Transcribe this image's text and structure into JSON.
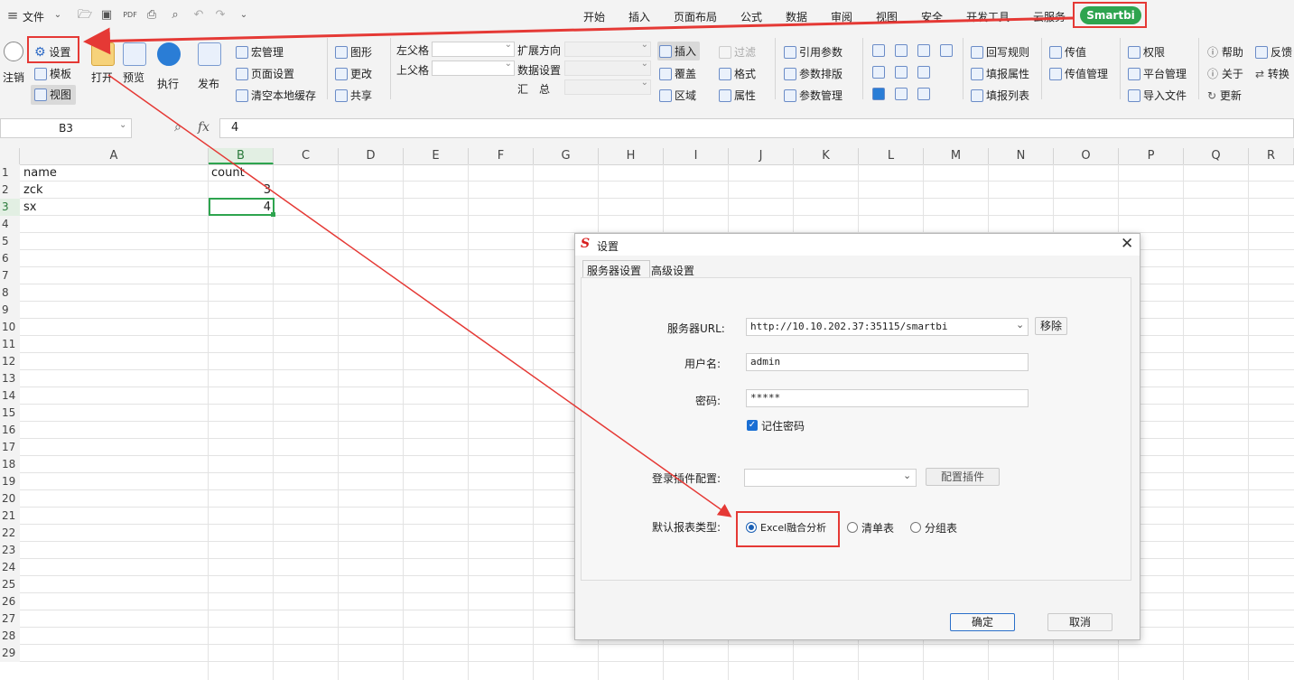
{
  "menubar": {
    "file_label": "文件",
    "tabs": [
      "开始",
      "插入",
      "页面布局",
      "公式",
      "数据",
      "审阅",
      "视图",
      "安全",
      "开发工具",
      "云服务"
    ],
    "smartbi_tab": "Smartbi"
  },
  "ribbon": {
    "logout": "注销",
    "settings": "设置",
    "template": "模板",
    "view": "视图",
    "open": "打开",
    "preview": "预览",
    "execute": "执行",
    "publish": "发布",
    "macro_manage": "宏管理",
    "page_setup": "页面设置",
    "clear_cache": "清空本地缓存",
    "shape": "图形",
    "change": "更改",
    "share": "共享",
    "left_parent": "左父格",
    "top_parent": "上父格",
    "expand_dir": "扩展方向",
    "data_setting": "数据设置",
    "summary": "汇　总",
    "insert": "插入",
    "cover": "覆盖",
    "area": "区域",
    "filter": "过滤",
    "format": "格式",
    "property": "属性",
    "ref_param": "引用参数",
    "param_layout": "参数排版",
    "param_manage": "参数管理",
    "writeback_rule": "回写规则",
    "fill_property": "填报属性",
    "fill_list": "填报列表",
    "pass_value": "传值",
    "pass_value_manage": "传值管理",
    "permission": "权限",
    "platform_manage": "平台管理",
    "import_file": "导入文件",
    "help": "帮助",
    "about": "关于",
    "update": "更新",
    "feedback": "反馈",
    "convert": "转换"
  },
  "formula": {
    "name_box": "B3",
    "fx": "fx",
    "value": "4"
  },
  "sheet": {
    "columns": [
      "A",
      "B",
      "C",
      "D",
      "E",
      "F",
      "G",
      "H",
      "I",
      "J",
      "K",
      "L",
      "M",
      "N",
      "O",
      "P",
      "Q",
      "R"
    ],
    "rows": [
      "1",
      "2",
      "3",
      "4",
      "5",
      "6",
      "7",
      "8",
      "9",
      "10",
      "11",
      "12",
      "13",
      "14",
      "15",
      "16",
      "17",
      "18",
      "19",
      "20",
      "21",
      "22",
      "23",
      "24",
      "25",
      "26",
      "27",
      "28",
      "29"
    ],
    "cells": {
      "a1": "name",
      "b1": "count",
      "a2": "zck",
      "b2": "3",
      "a3": "sx",
      "b3": "4"
    }
  },
  "dialog": {
    "title": "设置",
    "tabs": [
      "服务器设置",
      "高级设置"
    ],
    "server_url_label": "服务器URL:",
    "server_url": "http://10.10.202.37:35115/smartbi",
    "remove_button": "移除",
    "username_label": "用户名:",
    "username": "admin",
    "password_label": "密码:",
    "password": "*****",
    "remember_password": "记住密码",
    "login_plugin_label": "登录插件配置:",
    "config_plugin_button": "配置插件",
    "default_type_label": "默认报表类型:",
    "report_types": [
      "Excel融合分析",
      "清单表",
      "分组表"
    ],
    "ok": "确定",
    "cancel": "取消"
  },
  "colors": {
    "accent_green": "#2ea44f",
    "annotation_red": "#e53935",
    "radio_blue": "#1a5fb4"
  }
}
